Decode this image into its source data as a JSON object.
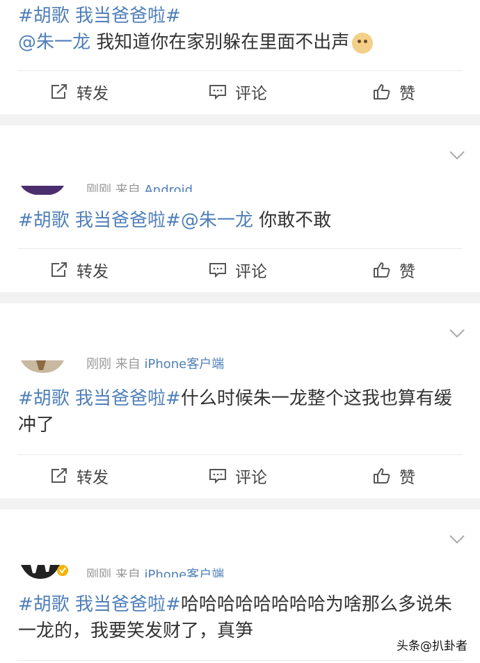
{
  "posts": [
    {
      "topic": "#胡歌 我当爸爸啦#",
      "mention": "@朱一龙",
      "body": " 我知道你在家别躲在里面不出声",
      "emoji": "doge-emoji"
    },
    {
      "meta_time": "刚刚",
      "meta_from": "来自",
      "meta_source": "Android",
      "topic": "#胡歌 我当爸爸啦#",
      "mention": "@朱一龙",
      "body": "  你敢不敢"
    },
    {
      "meta_time": "刚刚",
      "meta_from": "来自",
      "meta_source": "iPhone客户端",
      "topic": "#胡歌 我当爸爸啦#",
      "body": "什么时候朱一龙整个这我也算有缓冲了"
    },
    {
      "meta_time": "刚刚",
      "meta_from": "来自",
      "meta_source": "iPhone客户端",
      "topic": "#胡歌 我当爸爸啦#",
      "body": "哈哈哈哈哈哈哈哈为啥那么多说朱一龙的，我要笑发财了，真笋"
    }
  ],
  "actions": {
    "repost": "转发",
    "comment": "评论",
    "like": "赞"
  },
  "watermark": "头条@扒卦者",
  "colors": {
    "link": "#4f7fb8",
    "background": "#f2f2f2"
  }
}
